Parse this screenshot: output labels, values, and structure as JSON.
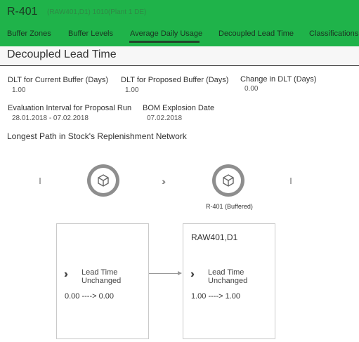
{
  "header": {
    "title": "R-401",
    "subtitle": "(RAW401,D1) 1010(Plant 1 DE)",
    "bg_color": "#1fb34a"
  },
  "tabs": [
    {
      "label": "Buffer Zones"
    },
    {
      "label": "Buffer Levels"
    },
    {
      "label": "Average Daily Usage",
      "active": true
    },
    {
      "label": "Decoupled Lead Time"
    },
    {
      "label": "Classifications"
    }
  ],
  "section": {
    "title": "Decoupled Lead Time"
  },
  "fields": {
    "dlt_current": {
      "label": "DLT for Current Buffer (Days)",
      "value": "1.00"
    },
    "dlt_proposed": {
      "label": "DLT for Proposed Buffer (Days)",
      "value": "1.00"
    },
    "dlt_change": {
      "label": "Change in DLT (Days)",
      "value": "0.00"
    },
    "eval_interval": {
      "label": "Evaluation Interval for Proposal Run",
      "value": "28.01.2018 - 07.02.2018"
    },
    "bom_date": {
      "label": "BOM Explosion Date",
      "value": "07.02.2018"
    }
  },
  "network": {
    "title": "Longest Path in Stock's Replenishment Network",
    "node_right_label": "R-401 (Buffered)",
    "node_icon": "cube-icon",
    "separator_icon": "chevron-right-triple-icon",
    "cards": [
      {
        "title": "",
        "status": "Lead Time Unchanged",
        "change": "0.00 ----> 0.00"
      },
      {
        "title": "RAW401,D1",
        "status": "Lead Time Unchanged",
        "change": "1.00 ----> 1.00"
      }
    ]
  }
}
